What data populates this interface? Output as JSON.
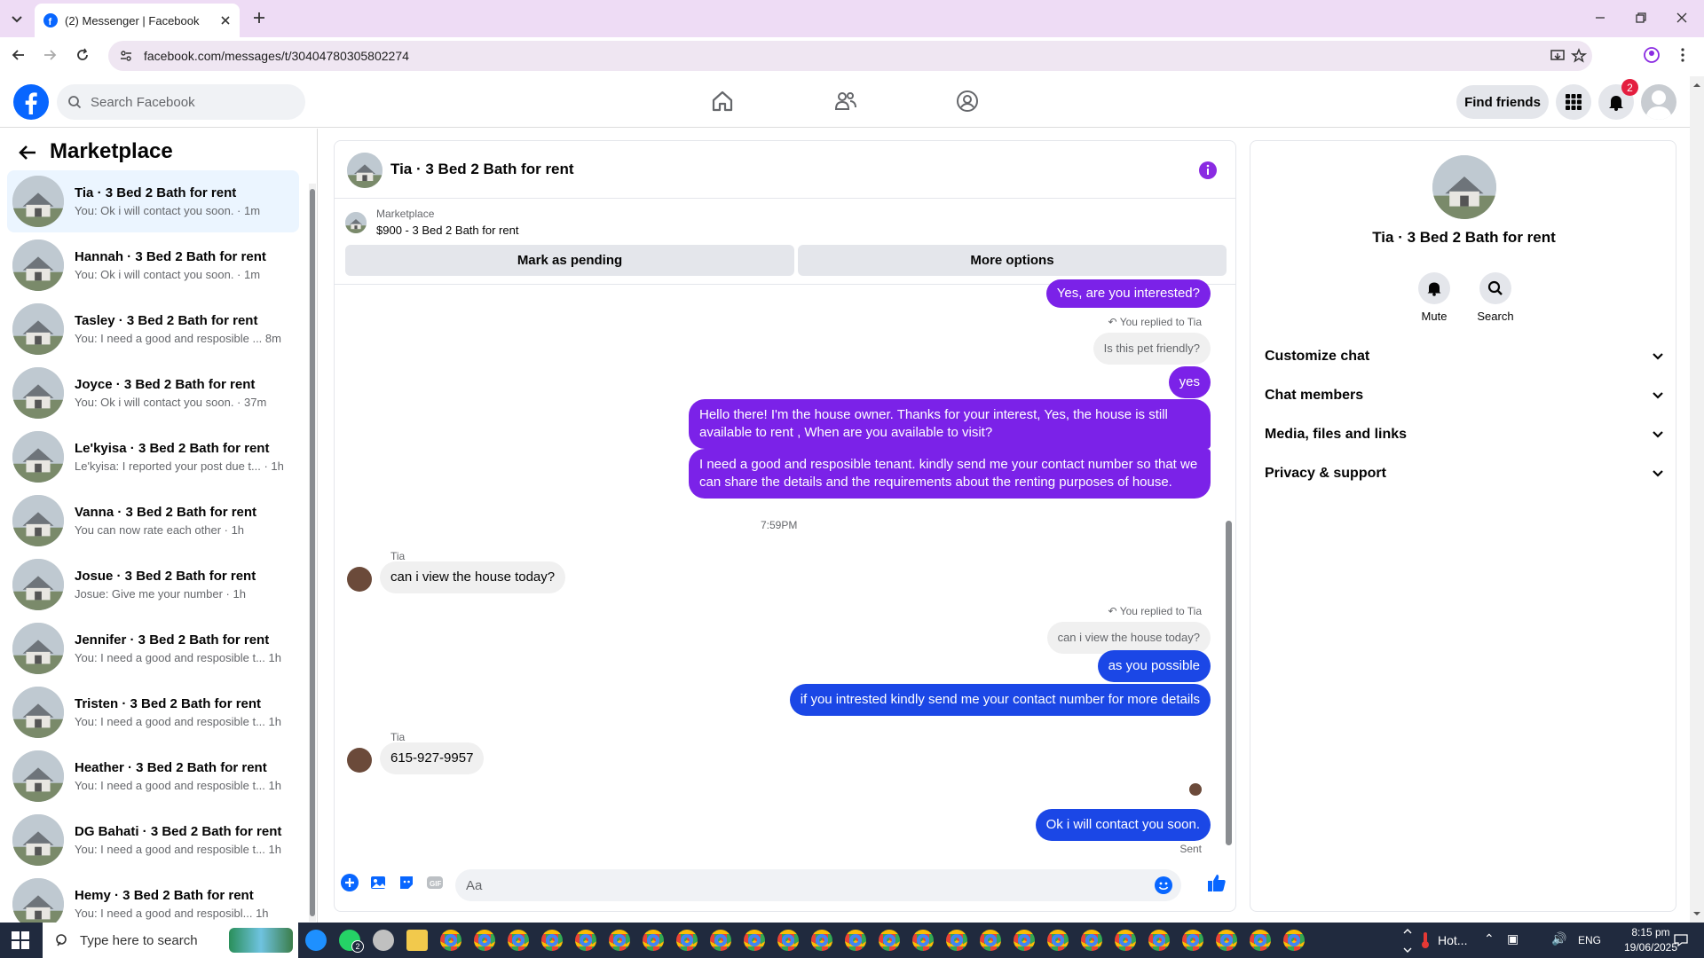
{
  "browser": {
    "tab_title": "(2) Messenger | Facebook",
    "url": "facebook.com/messages/t/30404780305802274"
  },
  "fb_header": {
    "search_placeholder": "Search Facebook",
    "find_friends": "Find friends",
    "notification_count": "2"
  },
  "left_panel": {
    "title": "Marketplace",
    "conversations": [
      {
        "name": "Tia · 3 Bed 2 Bath for rent",
        "preview": "You: Ok i will contact you soon. · 1m",
        "active": true
      },
      {
        "name": "Hannah · 3 Bed 2 Bath for rent",
        "preview": "You: Ok i will contact you soon. · 1m"
      },
      {
        "name": "Tasley · 3 Bed 2 Bath for rent",
        "preview": "You: I need a good and resposible ...  8m"
      },
      {
        "name": "Joyce · 3 Bed 2 Bath for rent",
        "preview": "You: Ok i will contact you soon. · 37m"
      },
      {
        "name": "Le'kyisa · 3 Bed 2 Bath for rent",
        "preview": "Le'kyisa: I reported your post due t...  · 1h"
      },
      {
        "name": "Vanna · 3 Bed 2 Bath for rent",
        "preview": "You can now rate each other · 1h"
      },
      {
        "name": "Josue · 3 Bed 2 Bath for rent",
        "preview": "Josue: Give me your number · 1h"
      },
      {
        "name": "Jennifer · 3 Bed 2 Bath for rent",
        "preview": "You: I need a good and resposible t...  1h"
      },
      {
        "name": "Tristen · 3 Bed 2 Bath for rent",
        "preview": "You: I need a good and resposible t...  1h"
      },
      {
        "name": "Heather · 3 Bed 2 Bath for rent",
        "preview": "You: I need a good and resposible t...  1h"
      },
      {
        "name": "DG Bahati · 3 Bed 2 Bath for rent",
        "preview": "You: I need a good and resposible t...  1h"
      },
      {
        "name": "Hemy · 3 Bed 2 Bath for rent",
        "preview": "You: I need a good and resposibl...  1h"
      }
    ]
  },
  "chat": {
    "title": "Tia · 3 Bed 2 Bath for rent",
    "listing_label": "Marketplace",
    "listing_text": "$900 - 3 Bed 2 Bath for rent",
    "mark_pending": "Mark as pending",
    "more_options": "More options",
    "msg_interested": "Yes, are you interested?",
    "replied_label": "You replied to Tia",
    "reply_pet": "Is this pet friendly?",
    "msg_yes": "yes",
    "msg_hello": "Hello there! I'm the house owner. Thanks for your interest, Yes, the house is still available to rent , When are you available to visit?",
    "msg_need": "I need a good and resposible tenant.  kindly send me your contact number so that we can share the details and the requirements about the renting purposes of house.",
    "time_divider": "7:59PM",
    "sender_tia": "Tia",
    "msg_view": "can i view the house today?",
    "reply_view": "can i view the house today?",
    "msg_possible": "as you possible",
    "msg_intrested": "if you intrested kindly send me your contact number for more details",
    "msg_number": "615-927-9957",
    "msg_contact": "Ok i will contact you soon.",
    "sent_label": "Sent",
    "composer_placeholder": "Aa"
  },
  "right_panel": {
    "title": "Tia · 3 Bed 2 Bath for rent",
    "mute": "Mute",
    "search": "Search",
    "sections": [
      "Customize chat",
      "Chat members",
      "Media, files and links",
      "Privacy & support"
    ]
  },
  "taskbar": {
    "search_placeholder": "Type here to search",
    "weather": "Hot...",
    "lang": "ENG",
    "time": "8:15 pm",
    "date": "19/06/2025",
    "whatsapp_badge": "2"
  },
  "colors": {
    "messenger_purple": "#7b22e8",
    "messenger_blue": "#1b47e6",
    "facebook_blue": "#0866ff"
  }
}
